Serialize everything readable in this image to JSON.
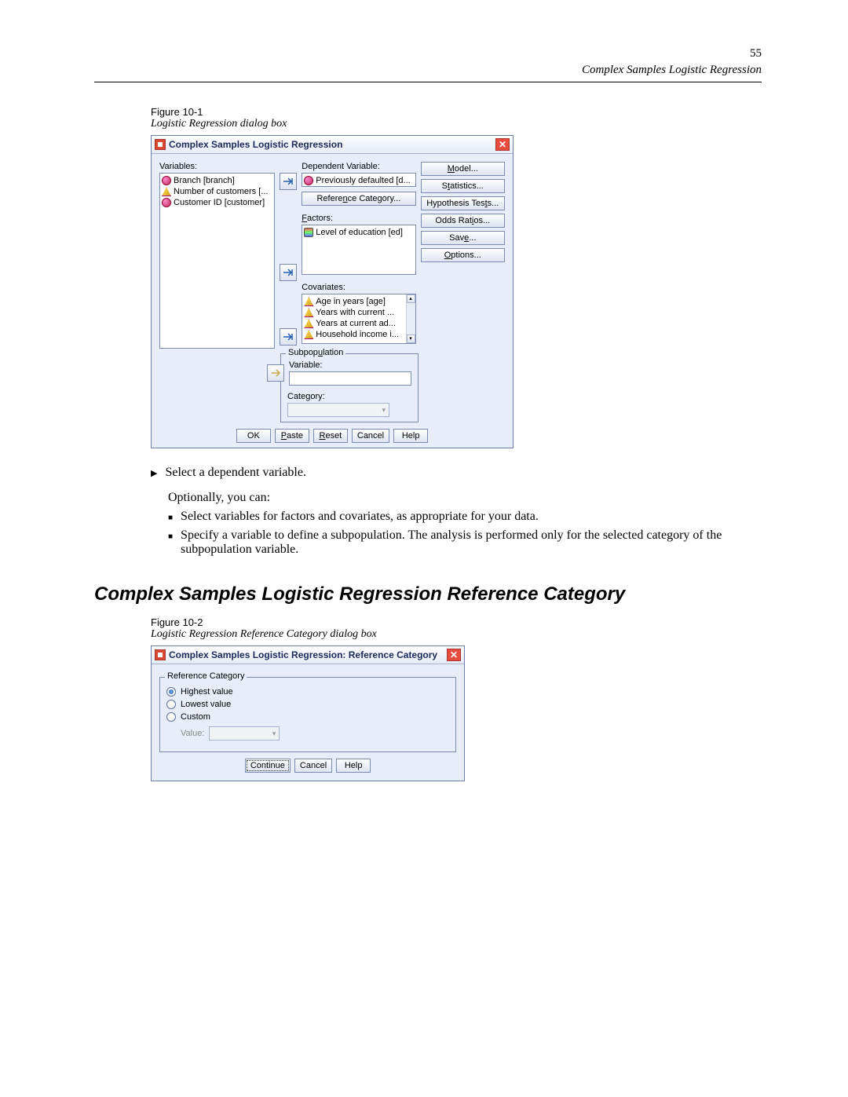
{
  "page_number": "55",
  "chapter_header": "Complex Samples Logistic Regression",
  "figure1": {
    "label": "Figure 10-1",
    "caption": "Logistic Regression dialog box",
    "title": "Complex Samples Logistic Regression",
    "variables_label": "Variables:",
    "variables": [
      "Branch [branch]",
      "Number of customers [...",
      "Customer ID [customer]"
    ],
    "dependent_label": "Dependent Variable:",
    "dependent_value": "Previously defaulted [d...",
    "ref_category_btn": "Reference Category...",
    "factors_label": "Factors:",
    "factors": [
      "Level of education [ed]"
    ],
    "covariates_label": "Covariates:",
    "covariates": [
      "Age in years [age]",
      "Years with current ...",
      "Years at current ad...",
      "Household income i..."
    ],
    "subpop_legend": "Subpopulation",
    "subpop_variable_label": "Variable:",
    "subpop_category_label": "Category:",
    "side_buttons": [
      "Model...",
      "Statistics...",
      "Hypothesis Tests...",
      "Odds Ratios...",
      "Save...",
      "Options..."
    ],
    "bottom_buttons": [
      "OK",
      "Paste",
      "Reset",
      "Cancel",
      "Help"
    ]
  },
  "body": {
    "step1": "Select a dependent variable.",
    "optional": "Optionally, you can:",
    "bullet1": "Select variables for factors and covariates, as appropriate for your data.",
    "bullet2": "Specify a variable to define a subpopulation. The analysis is performed only for the selected category of the subpopulation variable."
  },
  "section_heading": "Complex Samples Logistic Regression Reference Category",
  "figure2": {
    "label": "Figure 10-2",
    "caption": "Logistic Regression Reference Category dialog box",
    "title": "Complex Samples Logistic Regression: Reference Category",
    "fieldset_legend": "Reference Category",
    "radio_highest": "Highest value",
    "radio_lowest": "Lowest value",
    "radio_custom": "Custom",
    "value_label": "Value:",
    "bottom_buttons": [
      "Continue",
      "Cancel",
      "Help"
    ]
  }
}
